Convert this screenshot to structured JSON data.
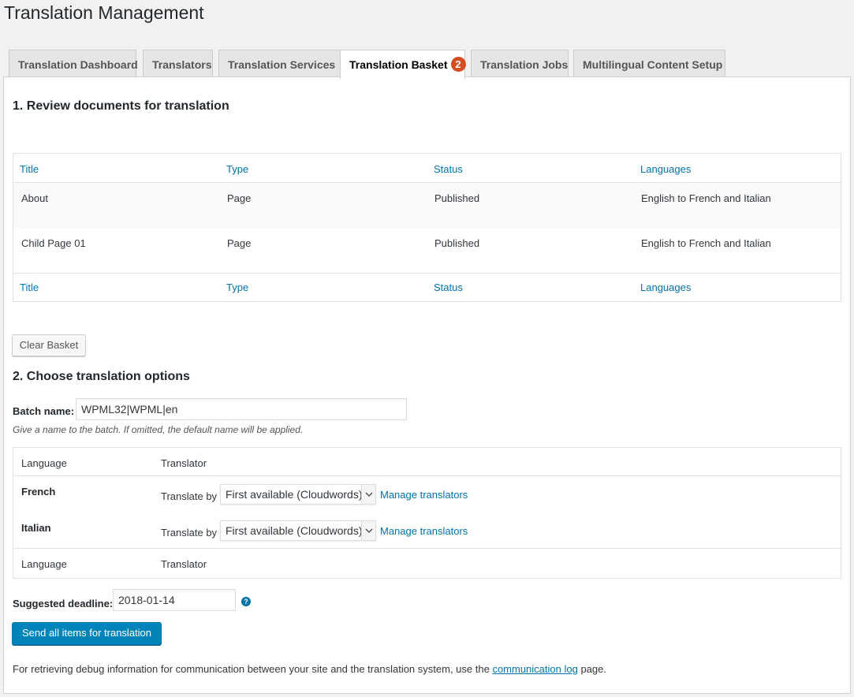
{
  "page": {
    "title": "Translation Management"
  },
  "tabs": [
    {
      "label": "Translation Dashboard"
    },
    {
      "label": "Translators"
    },
    {
      "label": "Translation Services"
    },
    {
      "label": "Translation Basket",
      "badge": "2",
      "active": true
    },
    {
      "label": "Translation Jobs"
    },
    {
      "label": "Multilingual Content Setup"
    }
  ],
  "review": {
    "heading": "1. Review documents for translation",
    "columns": [
      "Title",
      "Type",
      "Status",
      "Languages"
    ],
    "rows": [
      {
        "title": "About",
        "type": "Page",
        "status": "Published",
        "languages": "English to French and Italian"
      },
      {
        "title": "Child Page 01",
        "type": "Page",
        "status": "Published",
        "languages": "English to French and Italian"
      }
    ],
    "clear_button": "Clear Basket"
  },
  "options": {
    "heading": "2. Choose translation options",
    "batch_label": "Batch name:",
    "batch_value": "WPML32|WPML|en",
    "batch_hint": "Give a name to the batch. If omitted, the default name will be applied.",
    "lang_col": "Language",
    "translator_col": "Translator",
    "languages": [
      {
        "name": "French",
        "translate_by": "Translate by",
        "selected": "First available (Cloudwords)",
        "manage": "Manage translators"
      },
      {
        "name": "Italian",
        "translate_by": "Translate by",
        "selected": "First available (Cloudwords)",
        "manage": "Manage translators"
      }
    ],
    "deadline_label": "Suggested deadline:",
    "deadline_value": "2018-01-14",
    "help_glyph": "?",
    "send_button": "Send all items for translation",
    "footer_pre": "For retrieving debug information for communication between your site and the translation system, use the ",
    "footer_link": "communication log",
    "footer_post": " page."
  },
  "colors": {
    "link": "#0073aa",
    "primary": "#0085ba",
    "badge": "#d54e21"
  }
}
